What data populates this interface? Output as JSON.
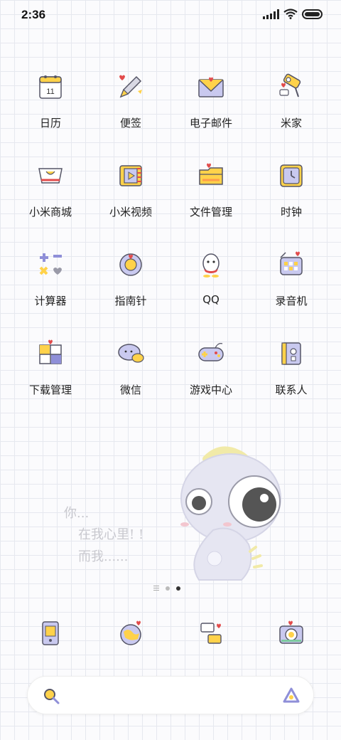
{
  "status_bar": {
    "time": "2:36"
  },
  "apps": [
    {
      "label": "日历",
      "icon": "calendar-icon",
      "day": "11"
    },
    {
      "label": "便签",
      "icon": "notes-pencil-icon"
    },
    {
      "label": "电子邮件",
      "icon": "envelope-icon"
    },
    {
      "label": "米家",
      "icon": "home-camera-icon"
    },
    {
      "label": "小米商城",
      "icon": "shopping-bag-icon"
    },
    {
      "label": "小米视频",
      "icon": "video-film-icon"
    },
    {
      "label": "文件管理",
      "icon": "folder-icon"
    },
    {
      "label": "时钟",
      "icon": "clock-icon"
    },
    {
      "label": "计算器",
      "icon": "calculator-icon"
    },
    {
      "label": "指南针",
      "icon": "compass-icon"
    },
    {
      "label": "QQ",
      "icon": "penguin-icon"
    },
    {
      "label": "录音机",
      "icon": "recorder-icon"
    },
    {
      "label": "下载管理",
      "icon": "download-gift-icon"
    },
    {
      "label": "微信",
      "icon": "chat-bubbles-icon"
    },
    {
      "label": "游戏中心",
      "icon": "gamepad-icon"
    },
    {
      "label": "联系人",
      "icon": "contacts-book-icon"
    }
  ],
  "wallpaper": {
    "line1": "你...",
    "line2": "在我心里! !",
    "line3": "而我......"
  },
  "dock": [
    {
      "icon": "phone-hi-icon"
    },
    {
      "icon": "browser-globe-icon"
    },
    {
      "icon": "messages-icon"
    },
    {
      "icon": "camera-icon"
    }
  ],
  "search": {
    "placeholder": ""
  },
  "colors": {
    "accent_yellow": "#ffd24a",
    "accent_purple": "#8f8fd8",
    "outline": "#555566",
    "heart_red": "#e24b4b"
  }
}
